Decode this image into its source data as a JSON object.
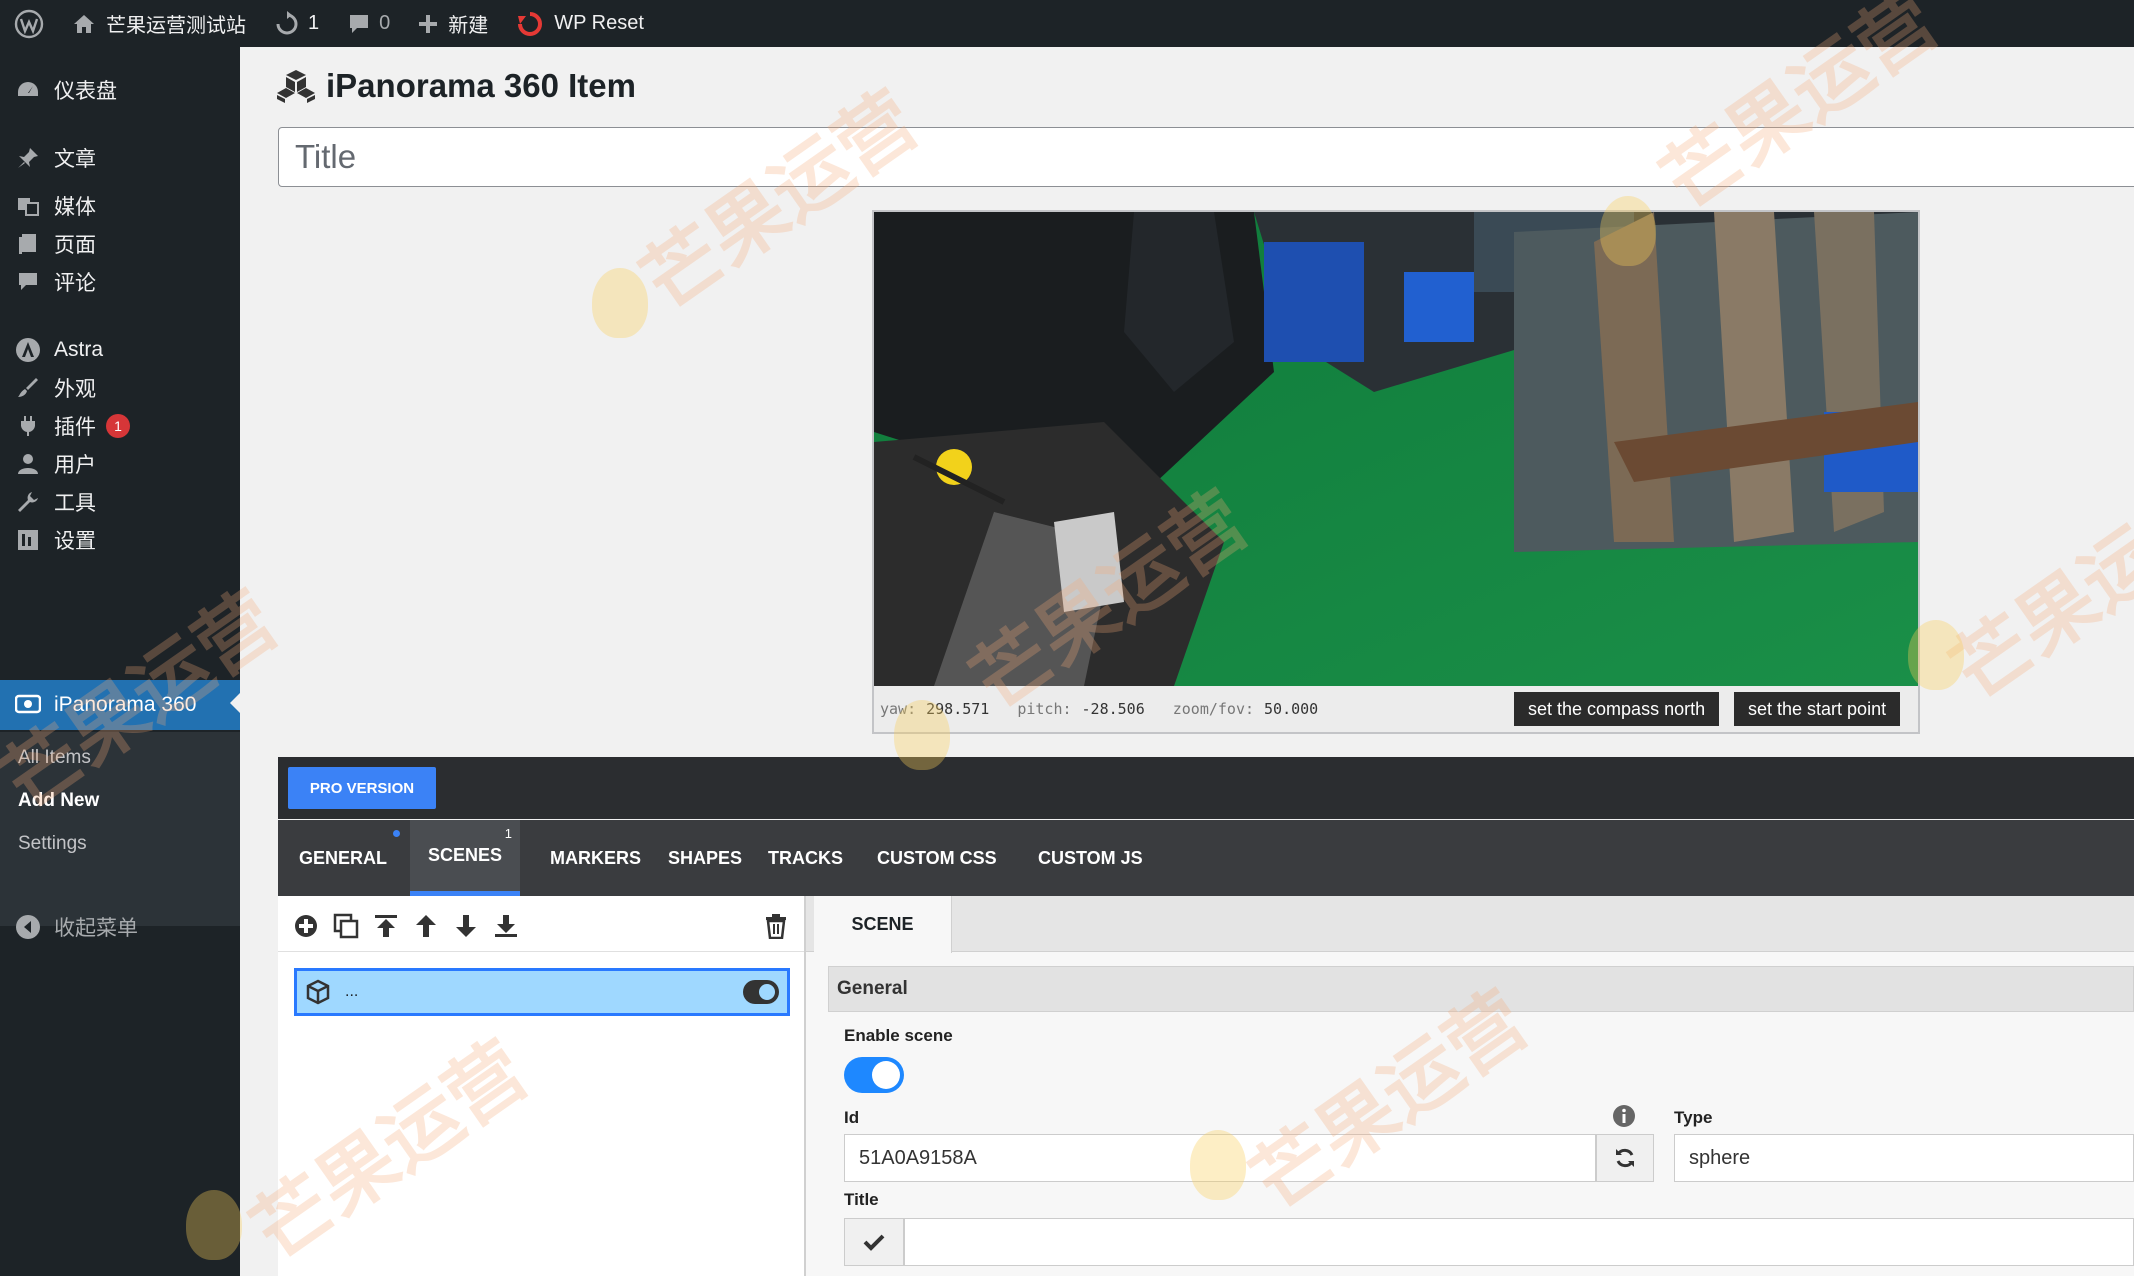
{
  "admin_bar": {
    "site_name": "芒果运营测试站",
    "updates_count": "1",
    "comments_count": "0",
    "new_label": "新建",
    "wp_reset_label": "WP Reset"
  },
  "sidebar": {
    "items": [
      {
        "label": "仪表盘",
        "icon": "dashboard-icon"
      },
      {
        "label": "文章",
        "icon": "pin-icon"
      },
      {
        "label": "媒体",
        "icon": "media-icon"
      },
      {
        "label": "页面",
        "icon": "page-icon"
      },
      {
        "label": "评论",
        "icon": "comment-icon"
      },
      {
        "label": "Astra",
        "icon": "astra-icon"
      },
      {
        "label": "外观",
        "icon": "brush-icon"
      },
      {
        "label": "插件",
        "icon": "plugin-icon",
        "badge": "1"
      },
      {
        "label": "用户",
        "icon": "user-icon"
      },
      {
        "label": "工具",
        "icon": "wrench-icon"
      },
      {
        "label": "设置",
        "icon": "settings-icon"
      },
      {
        "label": "iPanorama 360",
        "icon": "eye-icon",
        "active": true
      }
    ],
    "submenu": [
      "All Items",
      "Add New",
      "Settings"
    ],
    "collapse_label": "收起菜单"
  },
  "page": {
    "title": "iPanorama 360 Item",
    "title_placeholder": "Title"
  },
  "viewer": {
    "yaw_label": "yaw:",
    "yaw_value": "298.571",
    "pitch_label": "pitch:",
    "pitch_value": "-28.506",
    "zoom_label": "zoom/fov:",
    "zoom_value": "50.000",
    "compass_button": "set the compass north",
    "start_button": "set the start point"
  },
  "editor": {
    "pro_label": "PRO VERSION",
    "tabs": [
      {
        "label": "GENERAL"
      },
      {
        "label": "SCENES",
        "count": "1"
      },
      {
        "label": "MARKERS"
      },
      {
        "label": "SHAPES"
      },
      {
        "label": "TRACKS"
      },
      {
        "label": "CUSTOM CSS"
      },
      {
        "label": "CUSTOM JS"
      }
    ],
    "scene_item_label": "...",
    "scene_tab_label": "SCENE",
    "group_label": "General",
    "enable_label": "Enable scene",
    "id_label": "Id",
    "id_value": "51A0A9158A",
    "type_label": "Type",
    "type_value": "sphere",
    "title_label": "Title"
  },
  "watermark": "芒果运营"
}
